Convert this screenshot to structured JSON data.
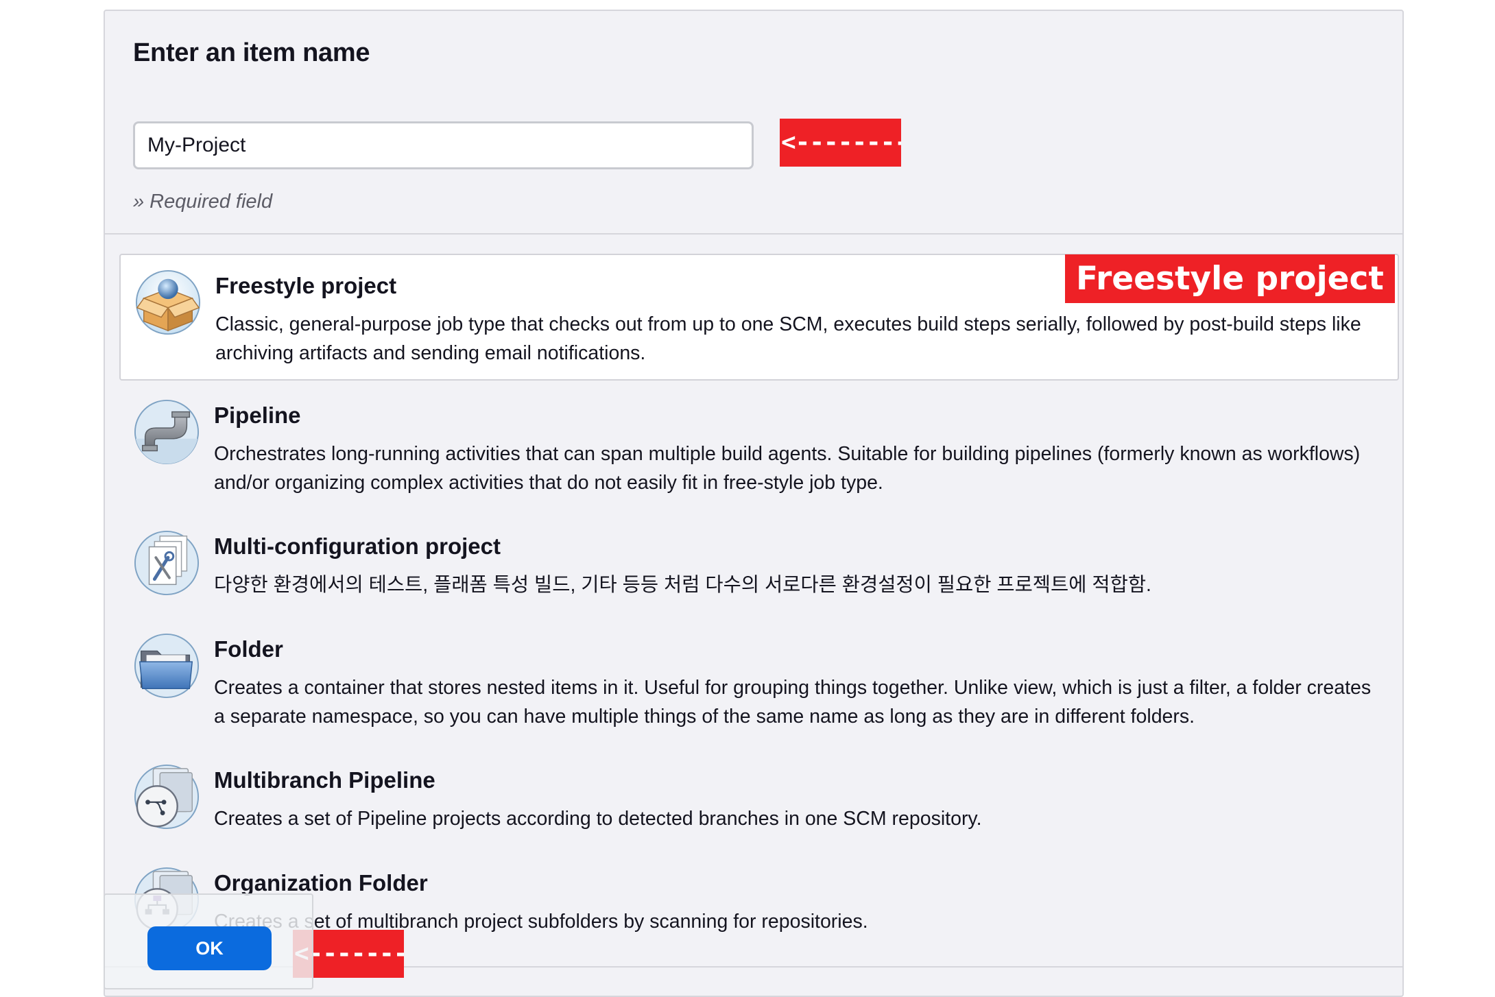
{
  "header": {
    "title": "Enter an item name",
    "name_value": "My-Project",
    "required_hint": "» Required field"
  },
  "annotations": {
    "name_arrow": "<--------",
    "selected_badge": "Freestyle project",
    "ok_arrow": "<-------",
    "color": "#ee2126"
  },
  "item_types": [
    {
      "title": "Freestyle project",
      "description": "Classic, general-purpose job type that checks out from up to one SCM, executes build steps serially, followed by post-build steps like archiving artifacts and sending email notifications.",
      "icon": "freestyle-box-icon",
      "selected": true
    },
    {
      "title": "Pipeline",
      "description": "Orchestrates long-running activities that can span multiple build agents. Suitable for building pipelines (formerly known as workflows) and/or organizing complex activities that do not easily fit in free-style job type.",
      "icon": "pipe-icon",
      "selected": false
    },
    {
      "title": "Multi-configuration project",
      "description": "다양한 환경에서의 테스트, 플래폼 특성 빌드, 기타 등등 처럼 다수의 서로다른 환경설정이 필요한 프로젝트에 적합함.",
      "icon": "multi-config-tools-icon",
      "selected": false
    },
    {
      "title": "Folder",
      "description": "Creates a container that stores nested items in it. Useful for grouping things together. Unlike view, which is just a filter, a folder creates a separate namespace, so you can have multiple things of the same name as long as they are in different folders.",
      "icon": "folder-icon",
      "selected": false
    },
    {
      "title": "Multibranch Pipeline",
      "description": "Creates a set of Pipeline projects according to detected branches in one SCM repository.",
      "icon": "branch-icon",
      "selected": false
    },
    {
      "title": "Organization Folder",
      "description": "Creates a set of multibranch project subfolders by scanning for repositories.",
      "icon": "organization-folder-icon",
      "selected": false
    }
  ],
  "footer": {
    "ok_label": "OK",
    "accent_color": "#0b6bde"
  }
}
